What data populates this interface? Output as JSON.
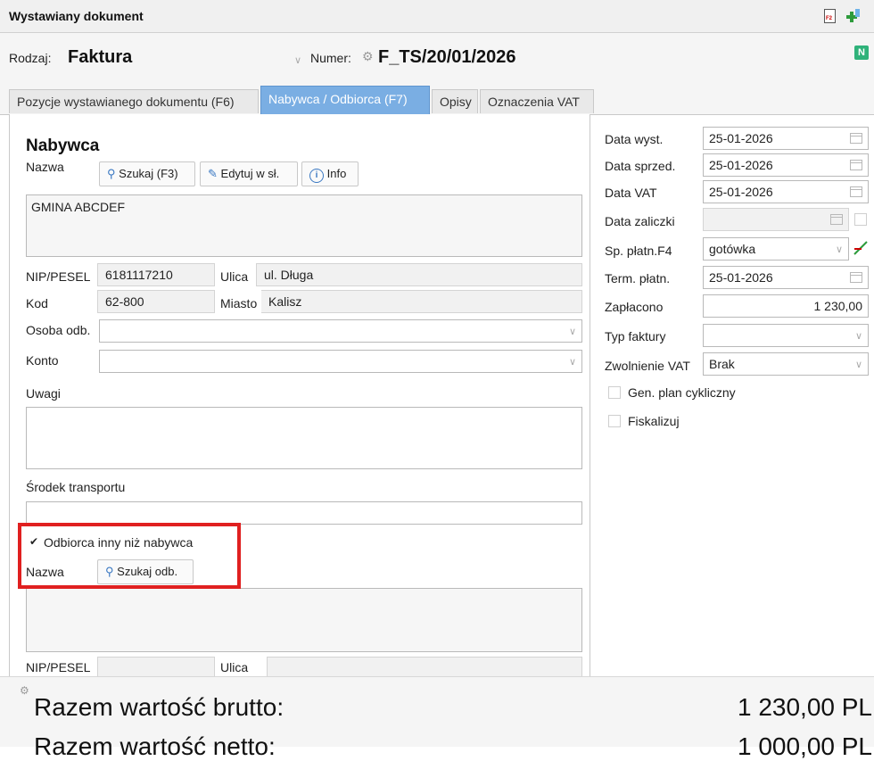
{
  "window": {
    "title": "Wystawiany dokument"
  },
  "header": {
    "rodzaj_label": "Rodzaj:",
    "rodzaj_value": "Faktura",
    "numer_label": "Numer:",
    "numer_value": "F_TS/20/01/2026",
    "n_badge": "N"
  },
  "tabs": [
    {
      "label": "Pozycje wystawianego dokumentu (F6)",
      "active": false
    },
    {
      "label": "Nabywca / Odbiorca (F7)",
      "active": true
    },
    {
      "label": "Opisy",
      "active": false
    },
    {
      "label": "Oznaczenia VAT",
      "active": false
    }
  ],
  "buyer": {
    "heading": "Nabywca",
    "nazwa_label": "Nazwa",
    "btn_szukaj": "Szukaj (F3)",
    "btn_edytuj": "Edytuj w sł.",
    "btn_info": "Info",
    "name_value": "GMINA ABCDEF",
    "nip_label": "NIP/PESEL",
    "nip_value": "6181117210",
    "ulica_label": "Ulica",
    "ulica_value": "ul. Długa",
    "kod_label": "Kod",
    "kod_value": "62-800",
    "miasto_label": "Miasto",
    "miasto_value": "Kalisz",
    "osoba_label": "Osoba odb.",
    "konto_label": "Konto",
    "uwagi_label": "Uwagi",
    "transport_label": "Środek transportu"
  },
  "recipient": {
    "checkbox_label": "Odbiorca inny niż nabywca",
    "checked": true,
    "nazwa_label": "Nazwa",
    "btn_szukaj": "Szukaj odb.",
    "nip_label": "NIP/PESEL",
    "ulica_label": "Ulica"
  },
  "right": {
    "data_wyst_label": "Data wyst.",
    "data_wyst_value": "25-01-2026",
    "data_sprzed_label": "Data sprzed.",
    "data_sprzed_value": "25-01-2026",
    "data_vat_label": "Data VAT",
    "data_vat_value": "25-01-2026",
    "data_zaliczki_label": "Data zaliczki",
    "sp_platn_label": "Sp. płatn.F4",
    "sp_platn_value": "gotówka",
    "term_platn_label": "Term. płatn.",
    "term_platn_value": "25-01-2026",
    "zaplacono_label": "Zapłacono",
    "zaplacono_value": "1 230,00",
    "typ_faktury_label": "Typ faktury",
    "zwolnienie_label": "Zwolnienie VAT",
    "zwolnienie_value": "Brak",
    "gen_plan_label": "Gen. plan cykliczny",
    "fiskalizuj_label": "Fiskalizuj"
  },
  "totals": {
    "brutto_label": "Razem wartość brutto:",
    "brutto_value": "1 230,00 PL",
    "netto_label": "Razem wartość netto:",
    "netto_value": "1 000,00 PL"
  },
  "colors": {
    "highlight": "#e02020",
    "active_tab": "#7aaee3",
    "badge": "#2fb27a"
  }
}
